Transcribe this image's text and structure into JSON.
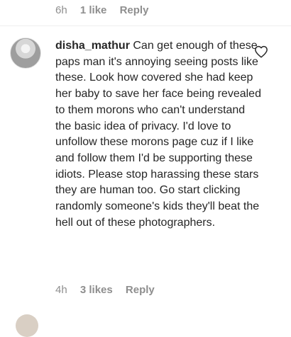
{
  "previous_comment": {
    "time": "6h",
    "likes": "1 like",
    "reply_label": "Reply"
  },
  "comment": {
    "username": "disha_mathur",
    "text": "Can get enough of these paps man it's annoying seeing posts like these. Look how covered she had keep her baby to save her face being revealed to them morons who can't understand the basic idea of privacy. I'd love to unfollow these morons page cuz if I like and follow them I'd be supporting these idiots. Please stop harassing these stars they are human too. Go start clicking randomly someone's kids they'll beat the hell out of these photographers.",
    "time": "4h",
    "likes": "3 likes",
    "reply_label": "Reply",
    "like_icon": "heart-outline-icon"
  },
  "next_comment": {
    "username": ""
  },
  "colors": {
    "text": "#262626",
    "meta": "#8e8e8e",
    "divider": "#efefef",
    "background": "#ffffff"
  }
}
